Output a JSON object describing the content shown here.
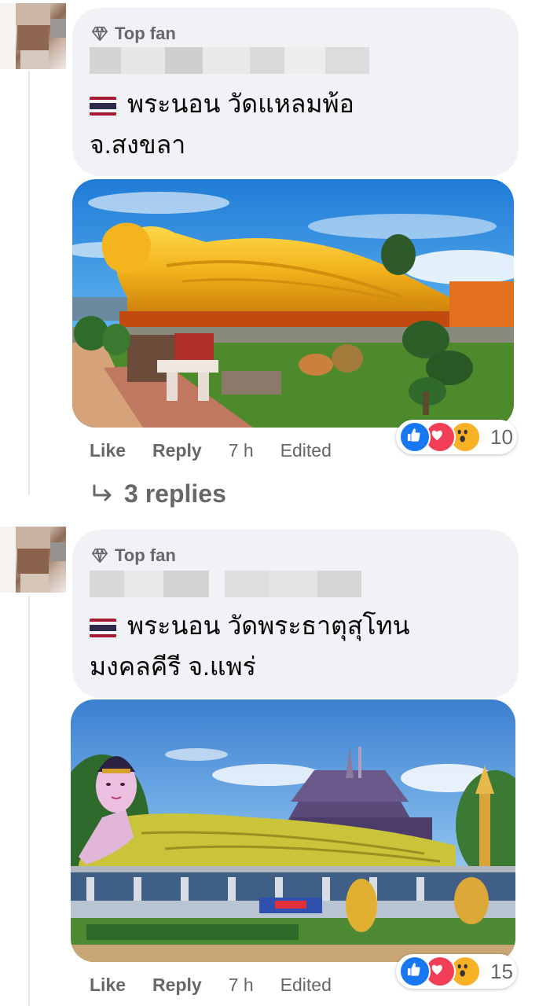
{
  "comments": [
    {
      "badge": "Top fan",
      "text_line1": "พระนอน วัดแหลมพ้อ",
      "text_line2": "จ.สงขลา",
      "actions": {
        "like": "Like",
        "reply": "Reply",
        "time": "7 h",
        "edited": "Edited"
      },
      "reaction_count": "10",
      "replies_label": "3 replies"
    },
    {
      "badge": "Top fan",
      "text_line1": "พระนอน วัดพระธาตุสุโทน",
      "text_line2": "มงคลคีรี จ.แพร่",
      "actions": {
        "like": "Like",
        "reply": "Reply",
        "time": "7 h",
        "edited": "Edited"
      },
      "reaction_count": "15"
    }
  ],
  "icons": {
    "badge": "diamond-icon",
    "flag": "thailand-flag-icon",
    "reply_arrow": "reply-arrow-icon",
    "reactions": [
      "like-reaction-icon",
      "love-reaction-icon",
      "wow-reaction-icon"
    ]
  },
  "colors": {
    "bubble": "#f0f2f5",
    "muted_text": "#65676b",
    "like_blue": "#1877f2",
    "love_red": "#f33e58",
    "wow_yellow": "#f7b125"
  }
}
